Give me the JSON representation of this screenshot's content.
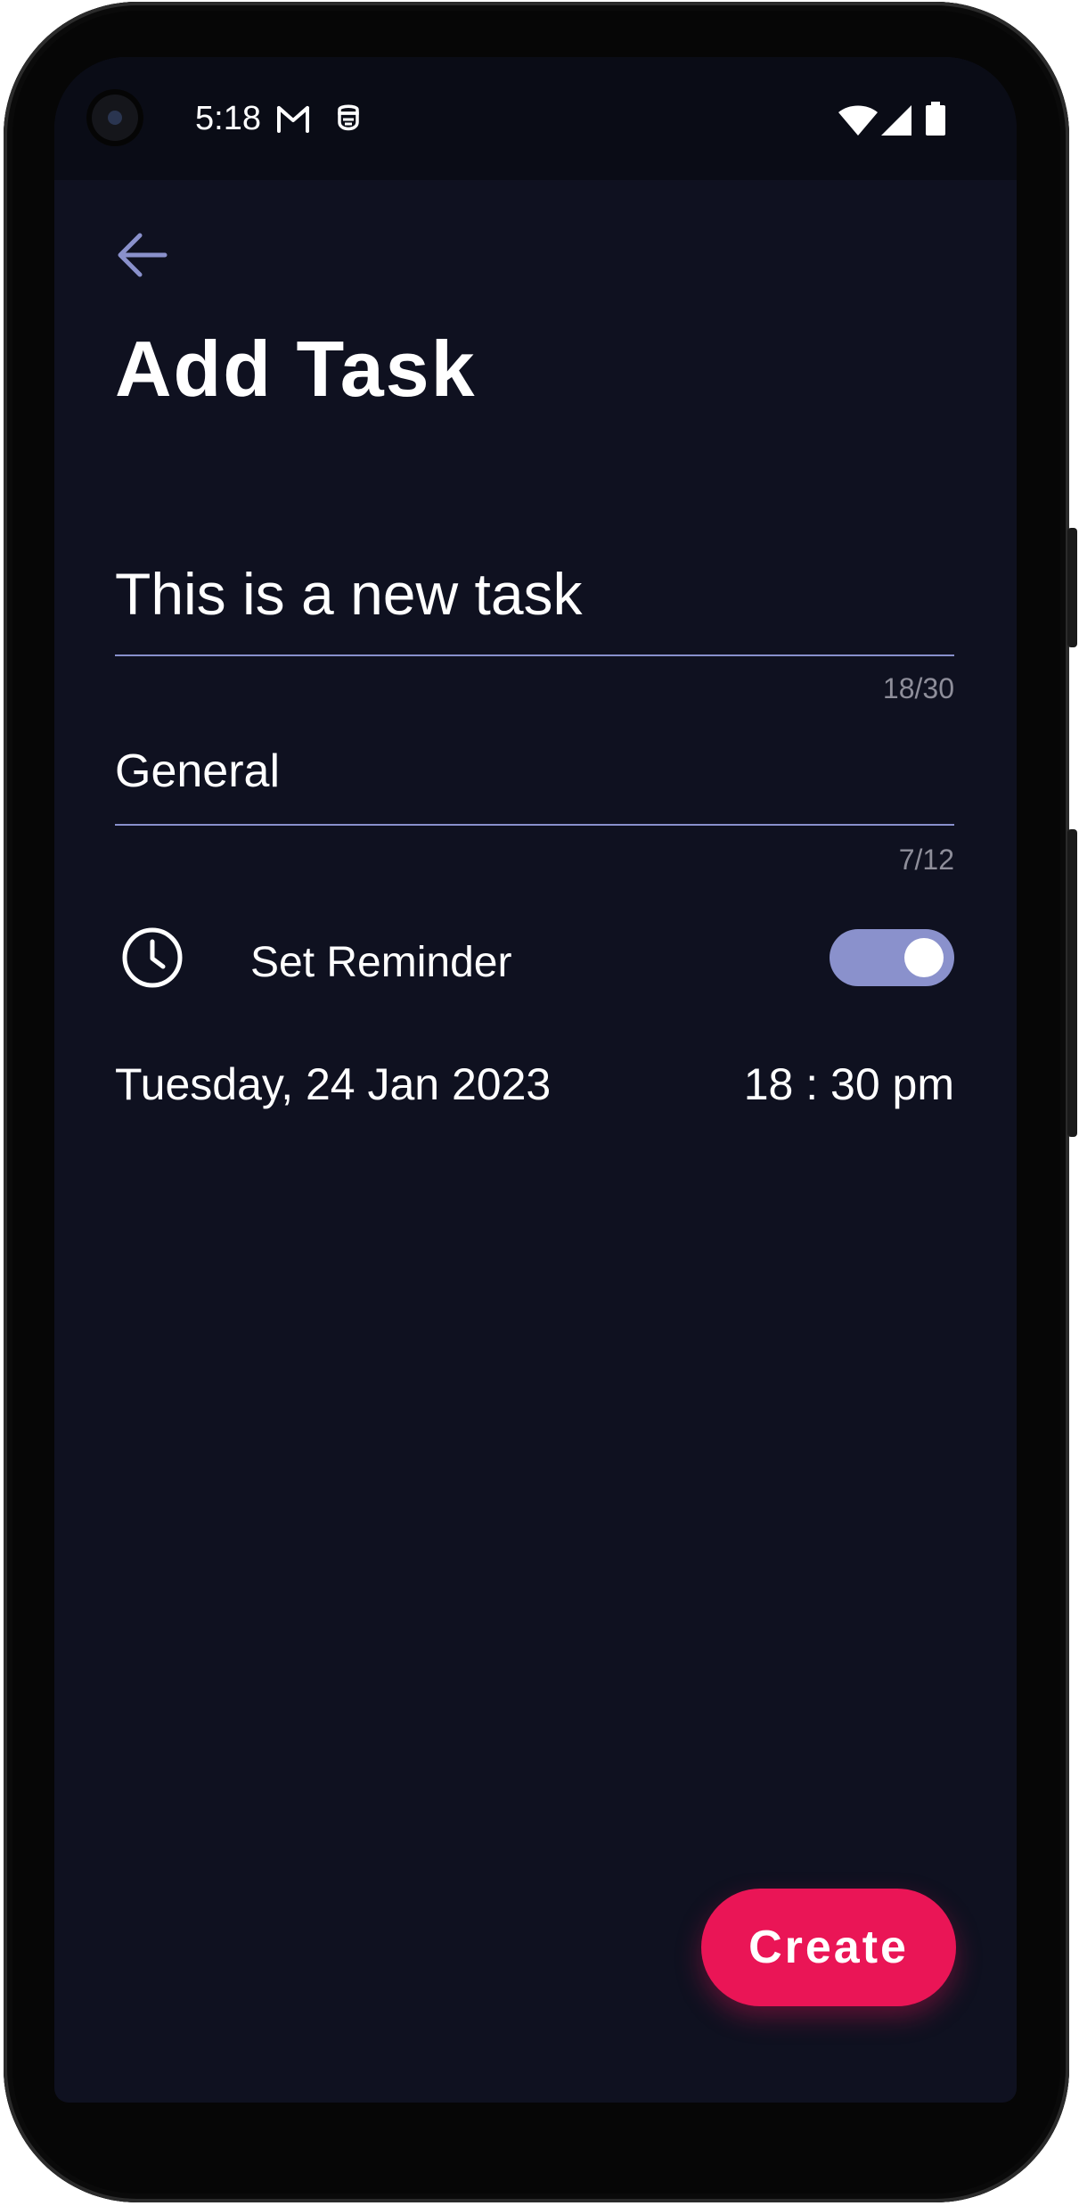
{
  "status_bar": {
    "time": "5:18",
    "icons": [
      "gmail-icon",
      "notification-icon",
      "wifi-icon",
      "cell-signal-icon",
      "battery-icon"
    ]
  },
  "header": {
    "back_icon": "arrow-back-icon",
    "title": "Add Task"
  },
  "form": {
    "task_title": {
      "value": "This is a new task",
      "counter": "18/30"
    },
    "category": {
      "value": "General",
      "counter": "7/12"
    },
    "reminder": {
      "icon": "clock-icon",
      "label": "Set Reminder",
      "enabled": true
    },
    "date": "Tuesday, 24 Jan 2023",
    "time": "18 : 30 pm"
  },
  "actions": {
    "create_label": "Create"
  },
  "colors": {
    "background": "#0f1120",
    "accent": "#8a91cc",
    "primary_button": "#ea1556",
    "text": "#ffffff",
    "counter_text": "#8e8e9a"
  }
}
